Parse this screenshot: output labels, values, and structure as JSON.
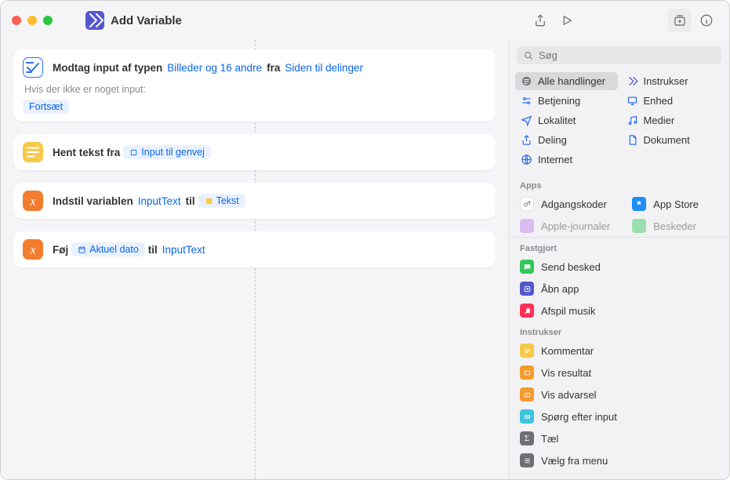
{
  "window": {
    "title": "Add Variable"
  },
  "actions": {
    "receive": {
      "prefix": "Modtag input af typen",
      "types": "Billeder og 16 andre",
      "from_word": "fra",
      "source": "Siden til delinger",
      "no_input_prompt": "Hvis der ikke er noget input:",
      "no_input_action": "Fortsæt"
    },
    "getText": {
      "prefix": "Hent tekst fra",
      "source": "Input til genvej"
    },
    "setVar": {
      "prefix": "Indstil variablen",
      "varname": "InputText",
      "to_word": "til",
      "value": "Tekst"
    },
    "append": {
      "prefix": "Føj",
      "value": "Aktuel dato",
      "to_word": "til",
      "varname": "InputText"
    }
  },
  "search": {
    "placeholder": "Søg"
  },
  "categories": [
    {
      "label": "Alle handlinger"
    },
    {
      "label": "Instrukser"
    },
    {
      "label": "Betjening"
    },
    {
      "label": "Enhed"
    },
    {
      "label": "Lokalitet"
    },
    {
      "label": "Medier"
    },
    {
      "label": "Deling"
    },
    {
      "label": "Dokument"
    },
    {
      "label": "Internet"
    }
  ],
  "sections": {
    "apps": "Apps",
    "pinned": "Fastgjort",
    "scripts": "Instrukser"
  },
  "apps": [
    {
      "label": "Adgangskoder"
    },
    {
      "label": "App Store"
    },
    {
      "label": "Apple-journaler"
    },
    {
      "label": "Beskeder"
    }
  ],
  "pinned": [
    {
      "label": "Send besked"
    },
    {
      "label": "Åbn app"
    },
    {
      "label": "Afspil musik"
    }
  ],
  "scripts": [
    {
      "label": "Kommentar"
    },
    {
      "label": "Vis resultat"
    },
    {
      "label": "Vis advarsel"
    },
    {
      "label": "Spørg efter input"
    },
    {
      "label": "Tæl"
    },
    {
      "label": "Vælg fra menu"
    }
  ]
}
